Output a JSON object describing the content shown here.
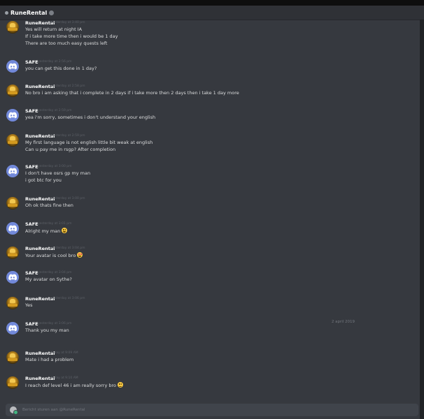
{
  "header": {
    "title": "RuneRental"
  },
  "messages": [
    {
      "author": "RuneRental",
      "avatar": "runerental-avatar",
      "timestamp": "yesterday at 3:40 pm",
      "lines": [
        "Yes will return at night IA",
        "If i take more time then i would be 1 day",
        "There are too much easy quests left"
      ]
    },
    {
      "author": "SAFE",
      "avatar": "discord-avatar",
      "timestamp": "yesterday at 2:56 pm",
      "lines": [
        "you can get this done in 1 day?"
      ]
    },
    {
      "author": "RuneRental",
      "avatar": "runerental-avatar",
      "timestamp": "yesterday at 2:58 pm",
      "lines": [
        "No bro i am asking that i complete in 2 days if i take more then 2 days then i take 1 day more"
      ]
    },
    {
      "author": "SAFE",
      "avatar": "discord-avatar",
      "timestamp": "yesterday at 2:59 pm",
      "lines": [
        "yea i'm sorry, sometimes i don't understand your english"
      ]
    },
    {
      "author": "RuneRental",
      "avatar": "runerental-avatar",
      "timestamp": "yesterday at 2:59 pm",
      "lines": [
        "My first language is not english little bit weak at english",
        "Can u pay me in rsgp? After completion"
      ]
    },
    {
      "author": "SAFE",
      "avatar": "discord-avatar",
      "timestamp": "yesterday at 3:00 pm",
      "lines": [
        "I don't have osrs gp my man",
        "i got btc for you"
      ]
    },
    {
      "author": "RuneRental",
      "avatar": "runerental-avatar",
      "timestamp": "yesterday at 3:00 pm",
      "lines": [
        "Oh ok thats fine then"
      ]
    },
    {
      "author": "SAFE",
      "avatar": "discord-avatar",
      "timestamp": "yesterday at 3:01 pm",
      "lines": [
        "Alright my man"
      ],
      "emoji": "smile-emoji"
    },
    {
      "author": "RuneRental",
      "avatar": "runerental-avatar",
      "timestamp": "yesterday at 3:04 pm",
      "lines": [
        "Your avatar is cool bro"
      ],
      "emoji": "heart-eyes-emoji"
    },
    {
      "author": "SAFE",
      "avatar": "discord-avatar",
      "timestamp": "yesterday at 3:04 pm",
      "lines": [
        "My avatar on Sythe?"
      ]
    },
    {
      "author": "RuneRental",
      "avatar": "runerental-avatar",
      "timestamp": "yesterday at 3:06 pm",
      "lines": [
        "Yes"
      ]
    },
    {
      "author": "SAFE",
      "avatar": "discord-avatar",
      "timestamp": "yesterday at 3:06 pm",
      "lines": [
        "Thank you my man"
      ]
    },
    {
      "author": "RuneRental",
      "avatar": "runerental-avatar",
      "timestamp": "today at 9:09 AM",
      "lines": [
        "Mate i had a problem"
      ]
    },
    {
      "author": "RuneRental",
      "avatar": "runerental-avatar",
      "timestamp": "today at 9:10 AM",
      "lines": [
        "I reach def level 46 i am really sorry bro"
      ],
      "emoji": "disappointed-emoji"
    }
  ],
  "date_divider": "2 april 2019",
  "composer": {
    "placeholder": "Bericht sturen aan @RuneRental"
  },
  "colors": {
    "background": "#36393f",
    "header": "#2f3136",
    "blurple": "#7289da",
    "text": "#dcddde",
    "muted": "#72767d"
  }
}
